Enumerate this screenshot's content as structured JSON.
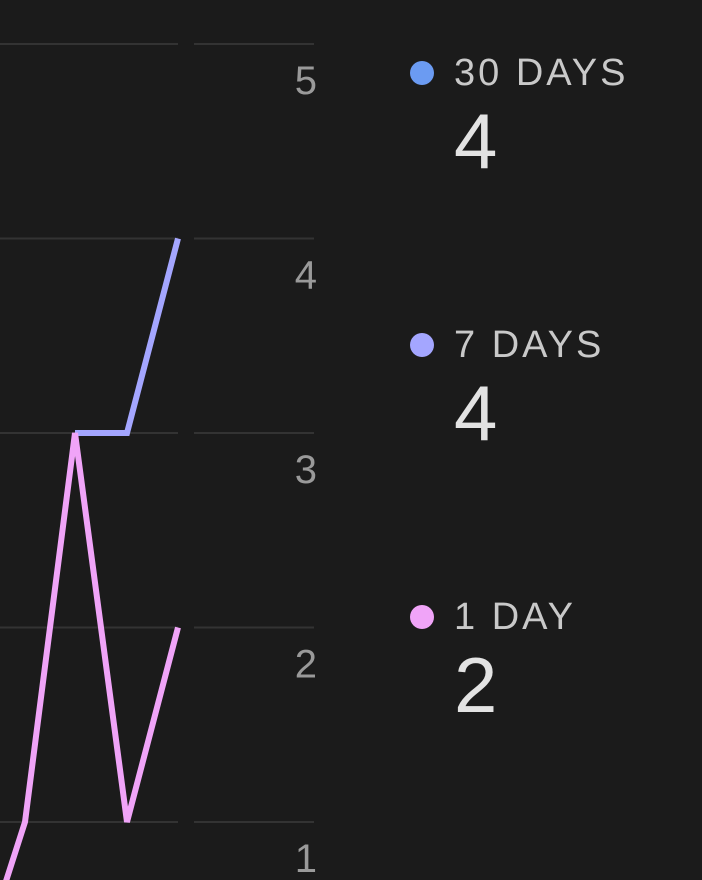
{
  "chart_data": {
    "type": "line",
    "y_ticks": [
      "5",
      "4",
      "3",
      "2",
      "1"
    ],
    "ylim": [
      1,
      5
    ],
    "grid": true,
    "series": [
      {
        "name": "30 DAYS",
        "color": "#6b9bf2",
        "value": "4",
        "points": []
      },
      {
        "name": "7 DAYS",
        "color": "#a4a6ff",
        "value": "4",
        "points": [
          [
            3,
            3
          ],
          [
            4,
            3
          ],
          [
            5,
            4
          ]
        ]
      },
      {
        "name": "1 DAY",
        "color": "#f0a4f8",
        "value": "2",
        "points": [
          [
            1,
            0.6
          ],
          [
            2,
            1
          ],
          [
            3,
            3
          ],
          [
            4,
            1
          ],
          [
            5,
            2
          ]
        ]
      }
    ]
  },
  "legend": {
    "items": [
      {
        "label": "30 DAYS",
        "value": "4",
        "color": "#6b9bf2"
      },
      {
        "label": "7 DAYS",
        "value": "4",
        "color": "#a4a6ff"
      },
      {
        "label": "1 DAY",
        "value": "2",
        "color": "#f0a4f8"
      }
    ]
  }
}
